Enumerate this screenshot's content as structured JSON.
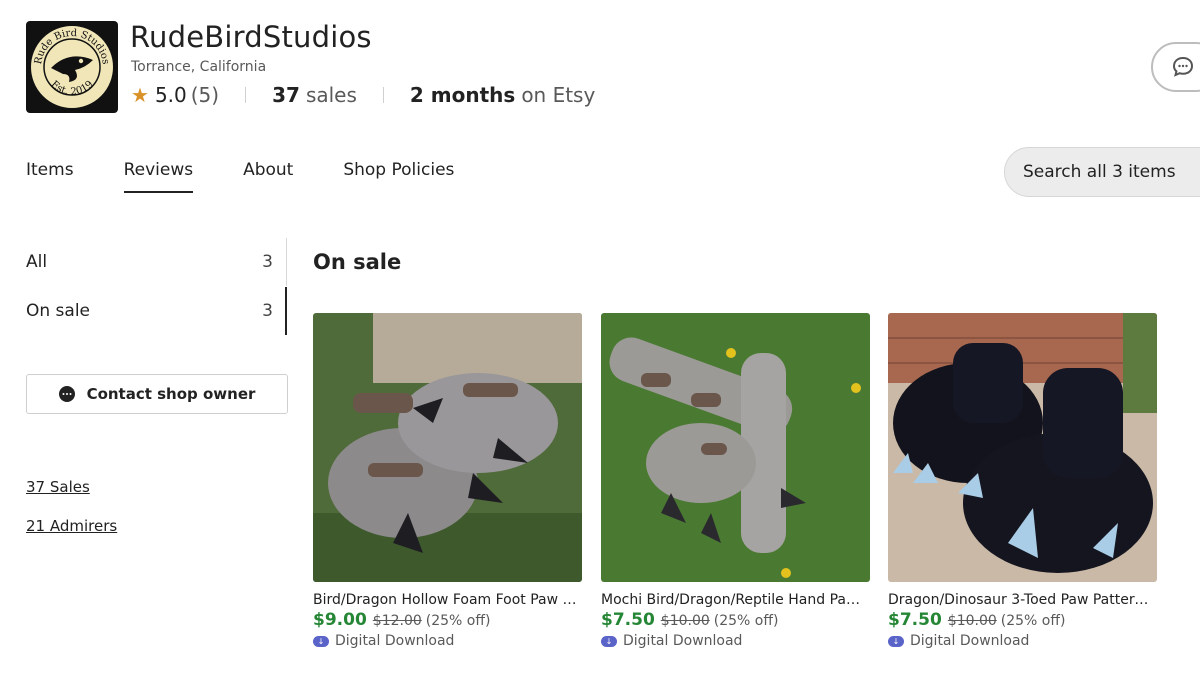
{
  "shop": {
    "name": "RudeBirdStudios",
    "location": "Torrance, California",
    "rating": "5.0",
    "rating_count": "(5)",
    "sales_count": "37",
    "sales_label": "sales",
    "tenure_strong": "2 months",
    "tenure_light": "on Etsy",
    "logo_text_top": "Rude Bird Studios",
    "logo_text_bottom": "Est. 2019"
  },
  "tabs": [
    "Items",
    "Reviews",
    "About",
    "Shop Policies"
  ],
  "active_tab": "Reviews",
  "search": {
    "placeholder": "Search all 3 items"
  },
  "sidebar": {
    "filters": [
      {
        "label": "All",
        "count": "3"
      },
      {
        "label": "On sale",
        "count": "3"
      }
    ],
    "contact_label": "Contact shop owner",
    "links": [
      "37 Sales",
      "21 Admirers"
    ]
  },
  "main": {
    "section_title": "On sale",
    "items": [
      {
        "title": "Bird/Dragon Hollow Foam Foot Paw Pa...",
        "price": "$9.00",
        "original_price": "$12.00",
        "discount": "(25% off)",
        "badge": "Digital Download"
      },
      {
        "title": "Mochi Bird/Dragon/Reptile Hand Paw ...",
        "price": "$7.50",
        "original_price": "$10.00",
        "discount": "(25% off)",
        "badge": "Digital Download"
      },
      {
        "title": "Dragon/Dinosaur 3-Toed Paw Pattern -...",
        "price": "$7.50",
        "original_price": "$10.00",
        "discount": "(25% off)",
        "badge": "Digital Download"
      }
    ]
  },
  "colors": {
    "price_green": "#258635",
    "star_gold": "#d9922a",
    "download_blue": "#5a63c8"
  }
}
